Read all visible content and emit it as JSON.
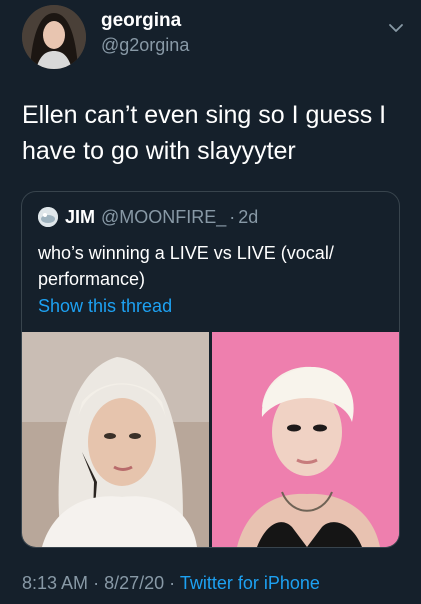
{
  "author": {
    "display_name": "georgina",
    "handle": "@g2orgina"
  },
  "tweet": {
    "text": "Ellen can’t even sing so I guess I have to go with slayyyter"
  },
  "quoted_tweet": {
    "author_name": "JIM",
    "author_handle": "@MOONFIRE_",
    "separator": "·",
    "time_ago": "2d",
    "text": "who’s winning a LIVE vs LIVE (vocal/ performance)",
    "thread_link": "Show this thread"
  },
  "meta": {
    "time": "8:13 AM",
    "separator": "·",
    "date": "8/27/20",
    "source": "Twitter for iPhone"
  },
  "colors": {
    "background": "#15202b",
    "secondary_text": "#8899a6",
    "link": "#1da1f2",
    "border": "#38444d"
  },
  "icons": {
    "more": "chevron-down-icon"
  }
}
